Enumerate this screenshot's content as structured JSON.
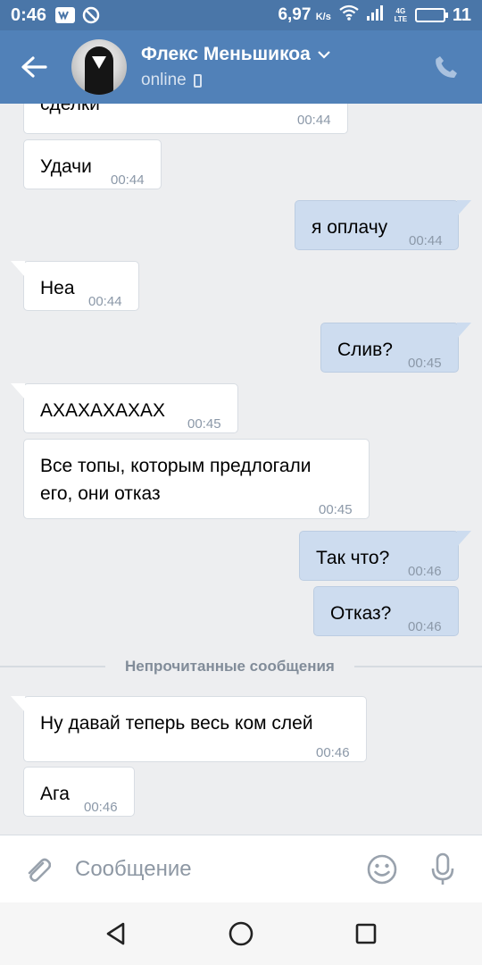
{
  "statusbar": {
    "time": "0:46",
    "speed": "6,97",
    "speed_unit": "K/s",
    "network": "4G LTE",
    "battery": "11"
  },
  "header": {
    "contact_name": "Флекс Меньшикоа",
    "status": "online"
  },
  "messages": [
    {
      "direction": "in",
      "text": "сделки",
      "time": "00:44"
    },
    {
      "direction": "in",
      "text": "Удачи",
      "time": "00:44"
    },
    {
      "direction": "out",
      "text": "я оплачу",
      "time": "00:44"
    },
    {
      "direction": "in",
      "text": "Неа",
      "time": "00:44"
    },
    {
      "direction": "out",
      "text": "Слив?",
      "time": "00:45"
    },
    {
      "direction": "in",
      "text": "АХАХАХАХАХ",
      "time": "00:45"
    },
    {
      "direction": "in",
      "text": "Все топы, которым предлогали\nего, они отказ",
      "time": "00:45"
    },
    {
      "direction": "out",
      "text": "Так что?",
      "time": "00:46"
    },
    {
      "direction": "out",
      "text": "Отказ?",
      "time": "00:46"
    },
    {
      "direction": "in",
      "text": "Ну давай теперь весь ком слей",
      "time": "00:46"
    },
    {
      "direction": "in",
      "text": "Ага",
      "time": "00:46"
    }
  ],
  "divider": {
    "label": "Непрочитанные сообщения"
  },
  "composer": {
    "placeholder": "Сообщение"
  },
  "icons": {
    "back": "arrow-left-icon",
    "call": "phone-icon",
    "attach": "paperclip-icon",
    "emoji": "smile-icon",
    "mic": "microphone-icon",
    "nav_back": "triangle-back-icon",
    "nav_home": "circle-home-icon",
    "nav_recent": "square-recent-icon"
  },
  "colors": {
    "header": "#5181b8",
    "statusbar": "#4a76a8",
    "background": "#edeef0",
    "incoming_bubble": "#ffffff",
    "outgoing_bubble": "#cddcef"
  }
}
